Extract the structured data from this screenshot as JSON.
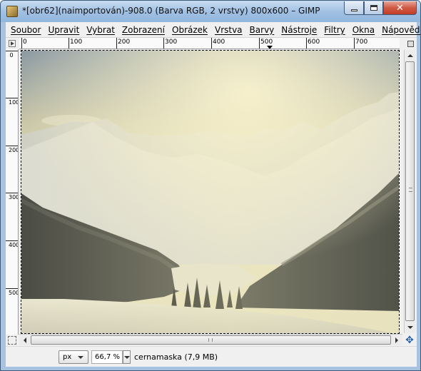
{
  "window": {
    "title": "*[obr62](naimportován)-908.0 (Barva RGB, 2 vrstvy) 800x600 – GIMP",
    "close_glyph": "✕"
  },
  "menubar": {
    "items": [
      {
        "label": "Soubor"
      },
      {
        "label": "Upravit"
      },
      {
        "label": "Vybrat"
      },
      {
        "label": "Zobrazení"
      },
      {
        "label": "Obrázek"
      },
      {
        "label": "Vrstva"
      },
      {
        "label": "Barvy"
      },
      {
        "label": "Nástroje"
      },
      {
        "label": "Filtry"
      },
      {
        "label": "Okna"
      },
      {
        "label": "Nápověda"
      }
    ]
  },
  "rulers": {
    "horizontal_labels": [
      "0",
      "100",
      "200",
      "300",
      "400",
      "500",
      "600",
      "700"
    ],
    "vertical_labels": [
      "0",
      "100",
      "200",
      "300",
      "400",
      "500"
    ]
  },
  "canvas": {
    "image_description_icon": "mountain-landscape-image"
  },
  "statusbar": {
    "unit": "px",
    "zoom": "66,7 %",
    "layer_info": "cernamaska (7,9 MB)"
  },
  "icons": {
    "app": "gimp-icon",
    "navigate": "navigate-icon",
    "quickmask": "quickmask-icon",
    "zoom_lock": "zoom-lock-icon"
  },
  "colors": {
    "titlebar": "#a8c3e0",
    "close_button": "#c43d24",
    "sky_haze": "#e9e3b8",
    "snow": "#e8e6d6"
  }
}
